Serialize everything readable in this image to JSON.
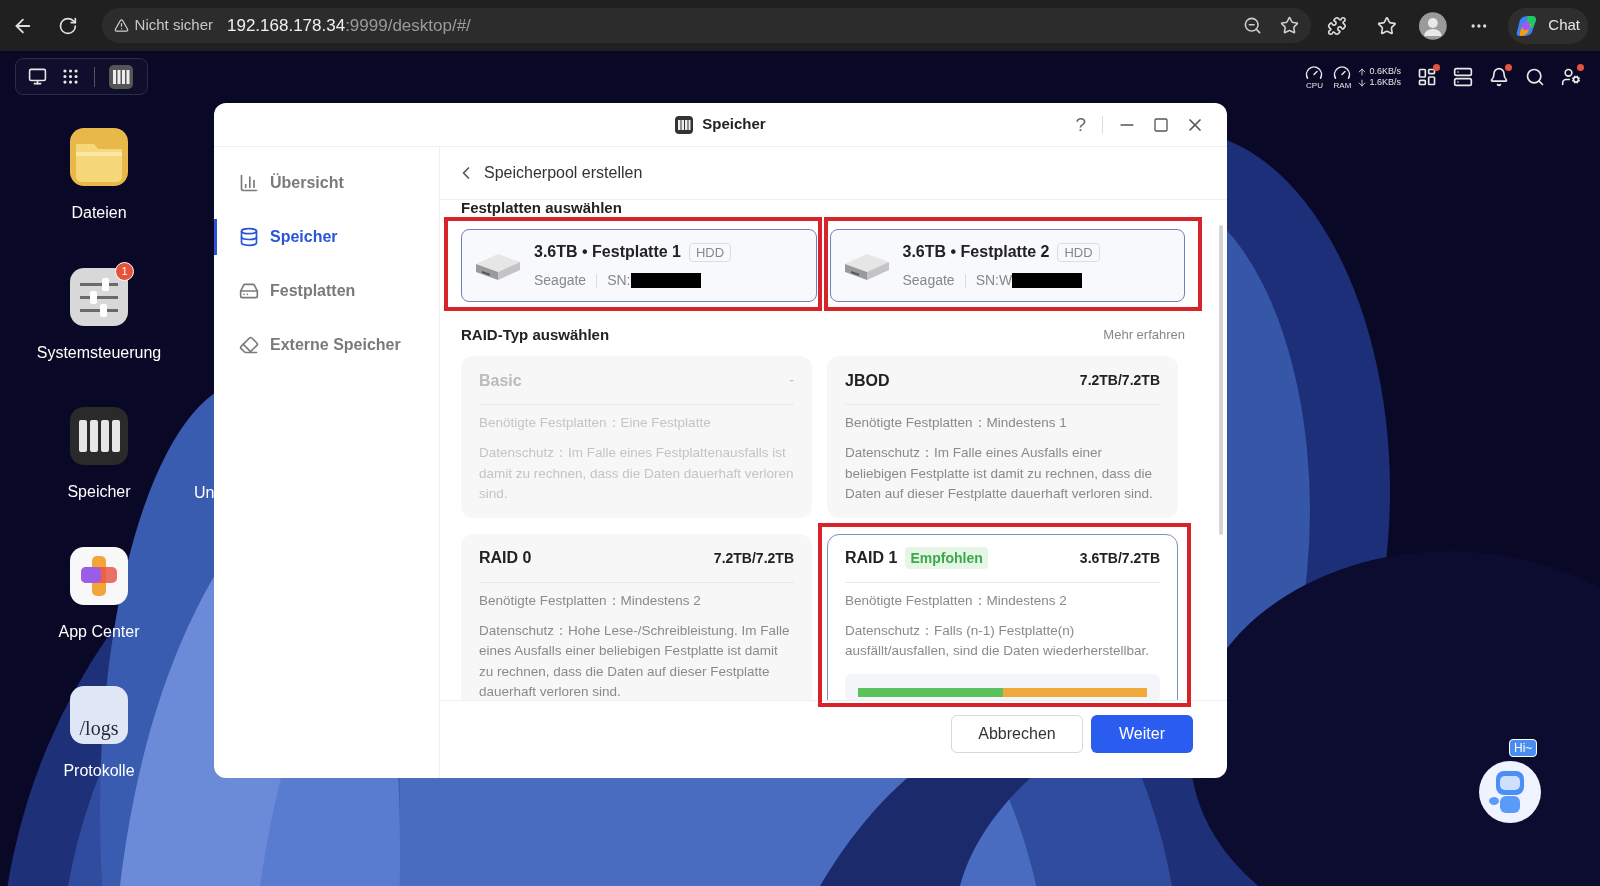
{
  "browser": {
    "security_label": "Nicht sicher",
    "url_host": "192.168.178.34",
    "url_path": ":9999/desktop/#/",
    "chat_label": "Chat"
  },
  "taskbar": {
    "cpu_label": "CPU",
    "ram_label": "RAM",
    "upload": "0.6KB/s",
    "download": "1.6KB/s"
  },
  "desktop_icons": [
    {
      "label": "Dateien",
      "kind": "folder"
    },
    {
      "label": "Systemsteuerung",
      "kind": "settings",
      "badge": "1"
    },
    {
      "label": "Speicher",
      "kind": "storage"
    },
    {
      "label": "App Center",
      "kind": "apps"
    },
    {
      "label": "Protokolle",
      "kind": "logs",
      "icon_text": "/logs"
    }
  ],
  "partial_label": "Un",
  "window": {
    "title": "Speicher",
    "help": "?"
  },
  "sidebar": {
    "items": [
      {
        "label": "Übersicht",
        "kind": "overview",
        "selected": false
      },
      {
        "label": "Speicher",
        "kind": "storage",
        "selected": true
      },
      {
        "label": "Festplatten",
        "kind": "disks",
        "selected": false
      },
      {
        "label": "Externe Speicher",
        "kind": "external",
        "selected": false
      }
    ]
  },
  "page": {
    "back_title": "Speicherpool erstellen",
    "disk_heading": "Festplatten auswählen",
    "raid_heading": "RAID-Typ auswählen",
    "learn_more": "Mehr erfahren"
  },
  "disks": [
    {
      "title": "3.6TB • Festplatte 1",
      "type": "HDD",
      "vendor": "Seagate",
      "serial": "SN:",
      "selected": true,
      "highlighted": true
    },
    {
      "title": "3.6TB • Festplatte 2",
      "type": "HDD",
      "vendor": "Seagate",
      "serial": "SN:W",
      "selected": true,
      "highlighted": true
    }
  ],
  "raid_types": [
    {
      "name": "Basic",
      "capacity": "-",
      "disabled": true,
      "selected": false,
      "highlighted": false,
      "requirement": "Benötigte Festplatten：Eine Festplatte",
      "protection": "Datenschutz：Im Falle eines Festplattenausfalls ist damit zu rechnen, dass die Daten dauerhaft verloren sind."
    },
    {
      "name": "JBOD",
      "capacity": "7.2TB/7.2TB",
      "disabled": false,
      "selected": false,
      "highlighted": false,
      "requirement": "Benötigte Festplatten：Mindestens 1",
      "protection": "Datenschutz：Im Falle eines Ausfalls einer beliebigen Festplatte ist damit zu rechnen, dass die Daten auf dieser Festplatte dauerhaft verloren sind."
    },
    {
      "name": "RAID 0",
      "capacity": "7.2TB/7.2TB",
      "disabled": false,
      "selected": false,
      "highlighted": false,
      "requirement": "Benötigte Festplatten：Mindestens 2",
      "protection": "Datenschutz：Hohe Lese-/Schreibleistung. Im Falle eines Ausfalls einer beliebigen Festplatte ist damit zu rechnen, dass die Daten auf dieser Festplatte dauerhaft verloren sind."
    },
    {
      "name": "RAID 1",
      "badge": "Empfohlen",
      "capacity": "3.6TB/7.2TB",
      "disabled": false,
      "selected": true,
      "highlighted": true,
      "requirement": "Benötigte Festplatten：Mindestens 2",
      "protection": "Datenschutz：Falls (n-1) Festplatte(n) ausfällt/ausfallen, sind die Daten wiederherstellbar.",
      "level": 0.5
    }
  ],
  "buttons": {
    "cancel": "Abbrechen",
    "next": "Weiter"
  },
  "assistant": {
    "bubble": "Hi~"
  }
}
